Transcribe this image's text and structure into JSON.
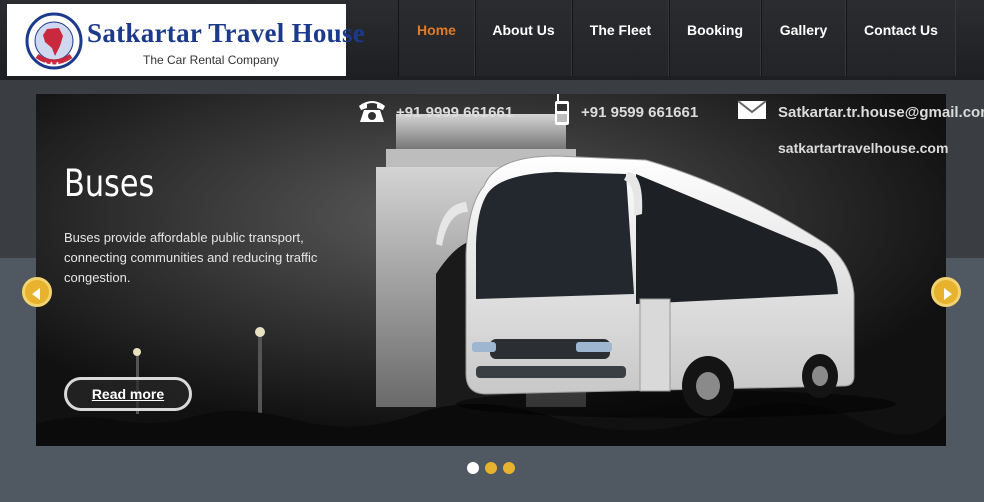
{
  "brand": {
    "name": "Satkartar Travel House",
    "tagline": "The Car Rental Company",
    "emblem_text": "SATKARTAR TRAVEL HOUSE"
  },
  "nav": {
    "items": [
      {
        "label": "Home",
        "active": true
      },
      {
        "label": "About Us",
        "active": false
      },
      {
        "label": "The Fleet",
        "active": false
      },
      {
        "label": "Booking",
        "active": false
      },
      {
        "label": "Gallery",
        "active": false
      },
      {
        "label": "Contact Us",
        "active": false
      }
    ]
  },
  "contact": {
    "phone1": "+91 9999 661661",
    "phone2": "+91 9599 661661",
    "email": "Satkartar.tr.house@gmail.com",
    "website": "satkartartravelhouse.com",
    "icons": [
      "telephone-icon",
      "mobile-phone-icon",
      "envelope-icon"
    ]
  },
  "slide": {
    "title": "Buses",
    "description": "Buses provide affordable public transport, connecting communities and reducing traffic congestion.",
    "read_more": "Read more",
    "total": 3,
    "current": 1
  },
  "colors": {
    "accent_orange": "#e27a26",
    "arrow_gold": "#e7b22d",
    "dot_active": "#ffffff",
    "dot_inactive": "#e7b22d",
    "logo_blue": "#1b3a8c",
    "page_bg": "#3a3e43"
  }
}
